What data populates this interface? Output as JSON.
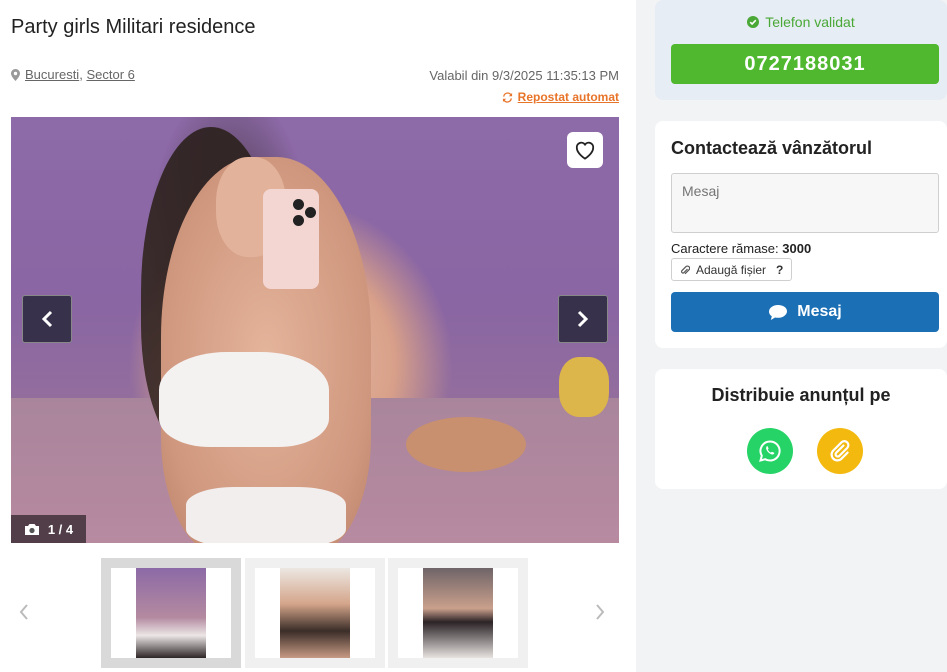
{
  "listing": {
    "title": "Party girls Militari residence",
    "location": {
      "city": "Bucuresti",
      "separator": ",",
      "area": "Sector 6"
    },
    "valid_text": "Valabil din 9/3/2025 11:35:13 PM",
    "reposted_text": "Repostat automat"
  },
  "gallery": {
    "counter": "1 / 4",
    "favorite_icon": "heart-outline-icon",
    "prev_icon": "chevron-left-icon",
    "next_icon": "chevron-right-icon",
    "thumbnails": [
      {
        "active": true
      },
      {
        "active": false
      },
      {
        "active": false
      }
    ]
  },
  "sidebar": {
    "phone": {
      "validated_label": "Telefon validat",
      "number": "0727188031",
      "color": "#4fb82e"
    },
    "contact": {
      "title": "Contactează vânzătorul",
      "message_placeholder": "Mesaj",
      "chars_label": "Caractere rămase:",
      "chars_remaining": "3000",
      "attach_label": "Adaugă fișier",
      "attach_help": "?",
      "send_label": "Mesaj",
      "send_color": "#1b6fb5"
    },
    "share": {
      "title": "Distribuie anunțul pe",
      "whatsapp_color": "#25d366",
      "link_color": "#f4b90e"
    }
  }
}
